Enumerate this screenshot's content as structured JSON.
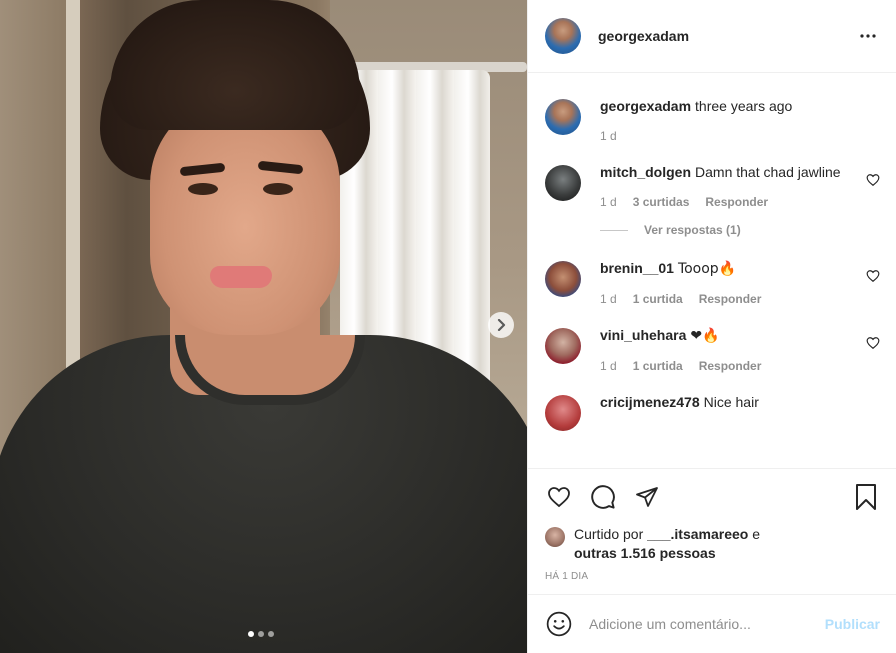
{
  "header": {
    "username": "georgexadam",
    "more_icon": "more-horizontal-icon"
  },
  "media": {
    "slide_count": 3,
    "active_slide": 1,
    "next_icon": "chevron-right-icon"
  },
  "caption": {
    "username": "georgexadam",
    "text": "three years ago",
    "time": "1 d"
  },
  "comments": [
    {
      "username": "mitch_dolgen",
      "text": "Damn that chad jawline",
      "time": "1 d",
      "likes": "3 curtidas",
      "reply": "Responder",
      "view_replies": "Ver respostas (1)"
    },
    {
      "username": "brenin__01",
      "text": "Tooop🔥",
      "time": "1 d",
      "likes": "1 curtida",
      "reply": "Responder"
    },
    {
      "username": "vini_uhehara",
      "text": "❤🔥",
      "time": "1 d",
      "likes": "1 curtida",
      "reply": "Responder"
    },
    {
      "username": "cricijmenez478",
      "text": "Nice hair"
    }
  ],
  "actions": {
    "like_icon": "heart-icon",
    "comment_icon": "comment-icon",
    "share_icon": "send-icon",
    "save_icon": "bookmark-icon"
  },
  "likes": {
    "prefix": "Curtido por",
    "user": "___.itsamareeo",
    "conjunction": "e",
    "others": "outras 1.516 pessoas"
  },
  "timestamp": "HÁ 1 DIA",
  "add_comment": {
    "placeholder": "Adicione um comentário...",
    "post_label": "Publicar",
    "emoji_icon": "smiley-icon"
  },
  "colors": {
    "text": "#262626",
    "muted": "#8e8e8e",
    "border": "#efefef",
    "post_button_disabled": "#b2dffc"
  }
}
